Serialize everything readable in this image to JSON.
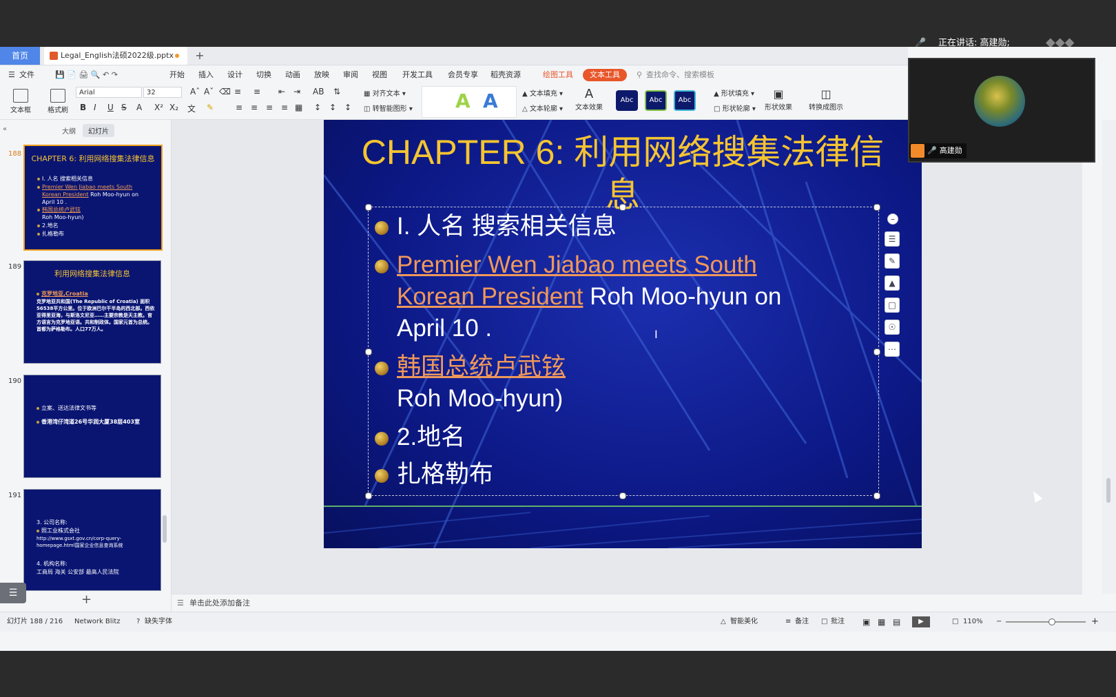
{
  "meeting": {
    "speaking_label": "正在讲话: 高建勋;",
    "participant_name": "高建勋"
  },
  "tabs": {
    "home": "首页",
    "document": "Legal_English法硕2022级.pptx",
    "new_tab": "+"
  },
  "menu": {
    "file": "文件",
    "items": [
      "开始",
      "插入",
      "设计",
      "切换",
      "动画",
      "放映",
      "审阅",
      "视图",
      "开发工具",
      "会员专享",
      "稻壳资源"
    ],
    "drawing_tools": "绘图工具",
    "text_tools": "文本工具",
    "search_placeholder": "查找命令、搜索模板"
  },
  "ribbon": {
    "textbox": "文本框",
    "format_painter": "格式刷",
    "font": "Arial",
    "font_size": "32",
    "align_text": "对齐文本",
    "smartart": "转智能图形",
    "text_fill": "文本填充",
    "text_outline": "文本轮廓",
    "text_effect": "文本效果",
    "style1": "Abc",
    "style2": "Abc",
    "style3": "Abc",
    "shape_fill": "形状填充",
    "shape_outline": "形状轮廓",
    "shape_effect": "形状效果",
    "convert_diagram": "转换成图示"
  },
  "left_panel": {
    "tab_outline": "大纲",
    "tab_slides": "幻灯片",
    "thumbs": [
      {
        "num": "188",
        "title": "CHAPTER 6: 利用网络搜集法律信息",
        "lines": [
          "I. 人名    搜索相关信息",
          "Premier Wen Jiabao meets South",
          "Korean President",
          "Roh Moo-hyun on",
          "April 10 .",
          "韩国总统卢武铉",
          "Roh Moo-hyun)",
          "2.地名",
          "扎格勒布"
        ]
      },
      {
        "num": "189",
        "title": "利用网络搜集法律信息",
        "lines": [
          "克罗地亚,Croatia",
          "克罗地亚共和国(The Republic of Croatia) 面积56538平方公里。位于欧洲巴尔干半岛的西北部。西依亚得里亚海，与斯洛文尼亚……主要宗教是天主教。官方语言为克罗地亚语。共和制政体。国家元首为总统。首都为萨格勒布。人口77万人。"
        ]
      },
      {
        "num": "190",
        "lines": [
          "立案、送达法律文书等",
          "香港湾仔湾道26号华润大厦38层403室"
        ]
      },
      {
        "num": "191",
        "lines": [
          "3. 公司名称:",
          "照工业株式会社",
          "http://www.gsxt.gov.cn/corp-query-homepage.html国家企业信息查询系统",
          "4. 机构名称:",
          "工商局    海关    公安部 最高人民法院"
        ]
      }
    ]
  },
  "slide": {
    "title": "CHAPTER 6: 利用网络搜集法律信息",
    "bullets": {
      "b1": "I. 人名    搜索相关信息",
      "b2_link1": "Premier Wen Jiabao meets South",
      "b2_link2": "Korean President",
      "b2_rest": " Roh Moo-hyun on",
      "b2_line3": "April 10 .",
      "b3_link": "韩国总统卢武铉",
      "b3_line2": "Roh Moo-hyun)",
      "b4": "2.地名",
      "b5": "扎格勒布"
    }
  },
  "notes_placeholder": "单击此处添加备注",
  "status": {
    "slide_count": "幻灯片 188 / 216",
    "theme": "Network Blitz",
    "missing_font": "缺失字体",
    "smart_beautify": "智能美化",
    "notes": "备注",
    "comments": "批注",
    "zoom": "110%"
  },
  "colors": {
    "accent": "#e8562a",
    "home_tab": "#4f86e8",
    "slide_bg": "#0c1885",
    "title_gold": "#f5c431",
    "link_orange": "#f0985a"
  }
}
